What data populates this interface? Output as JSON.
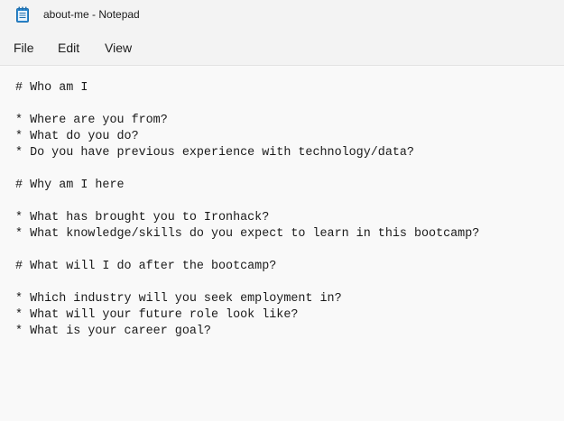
{
  "window": {
    "title": "about-me - Notepad",
    "app_icon": "notepad-icon"
  },
  "menu": {
    "items": [
      {
        "label": "File"
      },
      {
        "label": "Edit"
      },
      {
        "label": "View"
      }
    ]
  },
  "editor": {
    "lines": [
      "# Who am I",
      "",
      "* Where are you from?",
      "* What do you do?",
      "* Do you have previous experience with technology/data?",
      "",
      "# Why am I here",
      "",
      "* What has brought you to Ironhack?",
      "* What knowledge/skills do you expect to learn in this bootcamp?",
      "",
      "# What will I do after the bootcamp?",
      "",
      "* Which industry will you seek employment in?",
      "* What will your future role look like?",
      "* What is your career goal?"
    ]
  },
  "colors": {
    "chrome_background": "#f3f3f3",
    "editor_background": "#f9f9f9",
    "icon_accent": "#1f7fc6"
  }
}
